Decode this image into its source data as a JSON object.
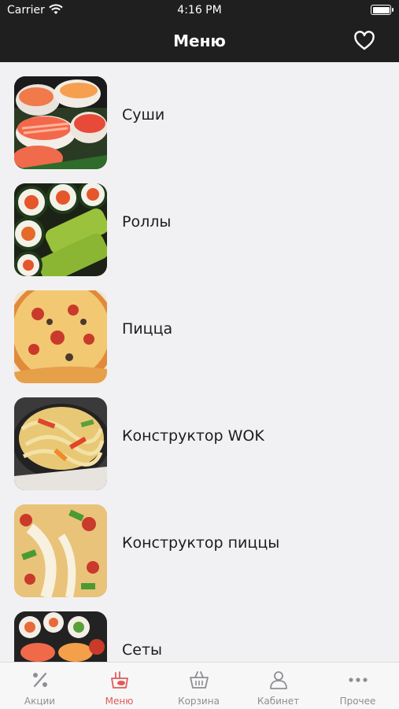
{
  "status": {
    "carrier": "Carrier",
    "time": "4:16 PM"
  },
  "header": {
    "title": "Меню",
    "favorite_icon": "heart-icon"
  },
  "menu": {
    "items": [
      {
        "label": "Суши",
        "image": "sushi-photo"
      },
      {
        "label": "Роллы",
        "image": "rolls-photo"
      },
      {
        "label": "Пицца",
        "image": "pizza-photo"
      },
      {
        "label": "Конструктор WOK",
        "image": "wok-photo"
      },
      {
        "label": "Конструктор пиццы",
        "image": "pizza-constructor-photo"
      },
      {
        "label": "Сеты",
        "image": "sets-photo"
      }
    ]
  },
  "tabs": [
    {
      "label": "Акции",
      "icon": "percent-icon",
      "active": false
    },
    {
      "label": "Меню",
      "icon": "menu-food-icon",
      "active": true
    },
    {
      "label": "Корзина",
      "icon": "basket-icon",
      "active": false
    },
    {
      "label": "Кабинет",
      "icon": "profile-icon",
      "active": false
    },
    {
      "label": "Прочее",
      "icon": "more-icon",
      "active": false
    }
  ],
  "colors": {
    "header_bg": "#1f1f1f",
    "accent": "#e05a5a",
    "background": "#f1f1f3",
    "inactive_tab": "#8e8e93"
  }
}
